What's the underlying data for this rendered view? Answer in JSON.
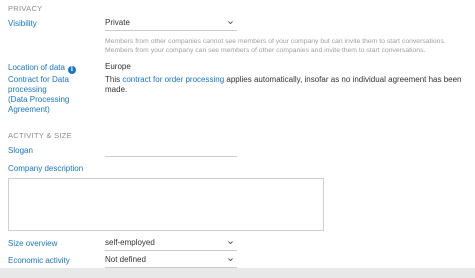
{
  "privacy": {
    "header": "PRIVACY",
    "visibility_label": "Visibility",
    "visibility_value": "Private",
    "visibility_hint_1": "Members from other companies cannot see members of your company but can invite them to start conversations.",
    "visibility_hint_2": "Members from your company can see members of other companies and invite them to start conversations.",
    "location_label": "Location of data",
    "location_value": "Europe",
    "contract_label_1": "Contract for Data",
    "contract_label_2": "processing",
    "contract_label_3": "(Data Processing",
    "contract_label_4": "Agreement)",
    "contract_text_prefix": "This ",
    "contract_link": "contract for order processing",
    "contract_text_suffix_1": " applies automatically, insofar as no individual agreement has been",
    "contract_text_suffix_2": "made."
  },
  "activity": {
    "header": "ACTIVITY & SIZE",
    "slogan_label": "Slogan",
    "slogan_value": "",
    "description_label": "Company description",
    "description_value": "",
    "size_label": "Size overview",
    "size_value": "self-employed",
    "economic_label": "Economic activity",
    "economic_value": "Not defined"
  },
  "icons": {
    "info": "info-icon",
    "chevron": "chevron-down-icon"
  },
  "colors": {
    "label": "#1a75c4",
    "section_header": "#8c8c8c",
    "hint": "#a0a0a0"
  }
}
